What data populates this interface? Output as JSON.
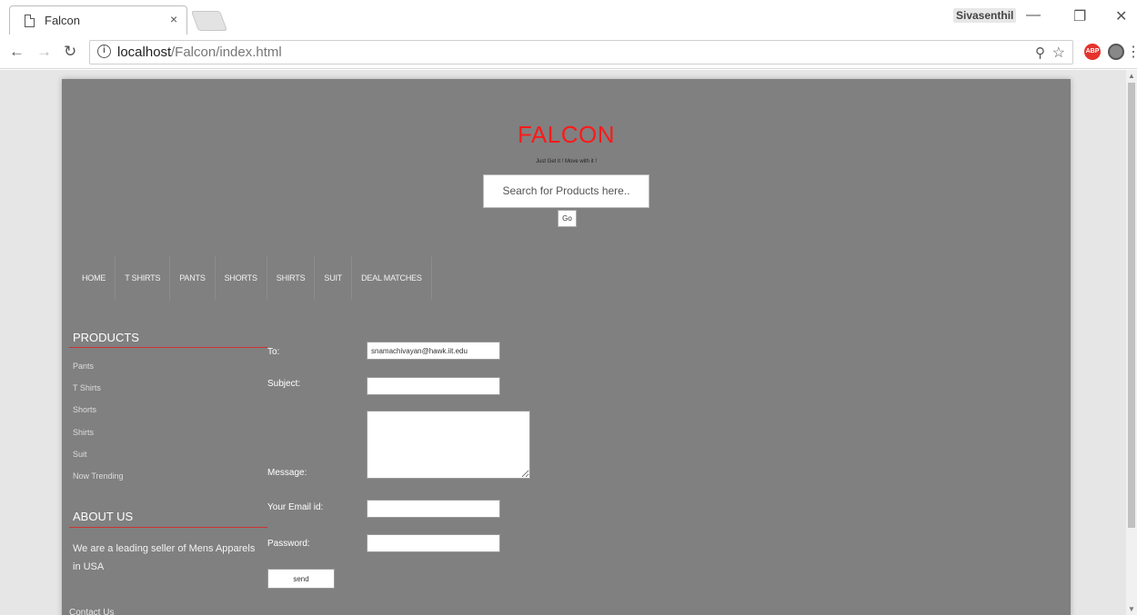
{
  "browser": {
    "tab_title": "Falcon",
    "tab_close": "×",
    "profile_name": "Sivasenthil",
    "url_host": "localhost",
    "url_path": "/Falcon/index.html",
    "extension_abp": "ABP"
  },
  "site": {
    "brand": "FALCON",
    "brand_color": "#ff1a1a",
    "tagline": "Just Get it ! Move with it !",
    "search_placeholder": "Search for Products here..",
    "go_label": "Go"
  },
  "nav": {
    "items": [
      "HOME",
      "T SHIRTS",
      "PANTS",
      "SHORTS",
      "SHIRTS",
      "SUIT",
      "DEAL MATCHES"
    ]
  },
  "sidebar": {
    "products_title": "PRODUCTS",
    "products": [
      "Pants",
      "T Shirts",
      "Shorts",
      "Shirts",
      "Suit",
      "Now Trending"
    ],
    "about_title": "ABOUT US",
    "about_text": "We are a leading seller of Mens Apparels in USA",
    "contact_title": "Contact Us"
  },
  "form": {
    "to_label": "To:",
    "to_value": "snamachivayan@hawk.iit.edu",
    "subject_label": "Subject:",
    "message_label": "Message:",
    "email_label": "Your Email id:",
    "password_label": "Password:",
    "send_label": "send"
  }
}
